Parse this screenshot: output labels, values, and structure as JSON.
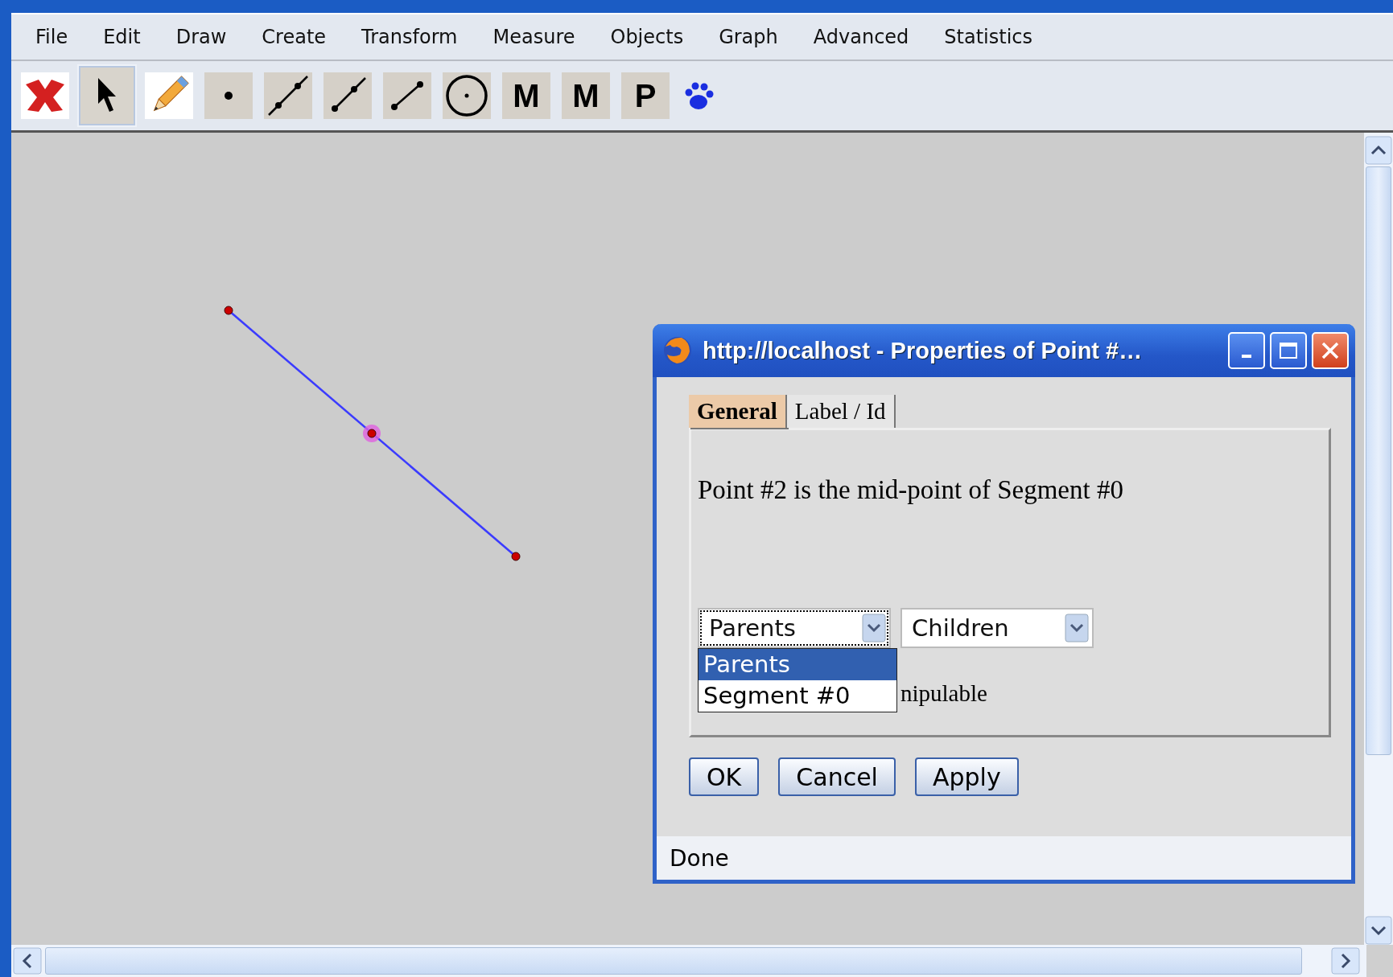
{
  "menu": [
    "File",
    "Edit",
    "Draw",
    "Create",
    "Transform",
    "Measure",
    "Objects",
    "Graph",
    "Advanced",
    "Statistics"
  ],
  "toolbar": [
    {
      "kind": "logo",
      "selected": false
    },
    {
      "kind": "arrow",
      "selected": true
    },
    {
      "kind": "pencil",
      "selected": false
    },
    {
      "kind": "point",
      "selected": false
    },
    {
      "kind": "line",
      "selected": false
    },
    {
      "kind": "ray",
      "selected": false
    },
    {
      "kind": "segment",
      "selected": false
    },
    {
      "kind": "circle",
      "selected": false
    },
    {
      "kind": "letter",
      "label": "M",
      "selected": false
    },
    {
      "kind": "letter",
      "label": "M",
      "selected": false
    },
    {
      "kind": "letter",
      "label": "P",
      "selected": false
    },
    {
      "kind": "paw",
      "selected": false
    }
  ],
  "dialog": {
    "title": "http://localhost - Properties of Point #…",
    "tabs": [
      {
        "label": "General",
        "selected": true
      },
      {
        "label": "Label / Id",
        "selected": false
      }
    ],
    "message": "Point #2 is the mid-point of Segment #0",
    "selects": [
      {
        "value": "Parents",
        "open": true,
        "options": [
          {
            "label": "Parents",
            "selected": true
          },
          {
            "label": "Segment #0",
            "selected": false
          }
        ]
      },
      {
        "value": "Children",
        "open": false
      }
    ],
    "partial_text": "nipulable",
    "buttons": [
      "OK",
      "Cancel",
      "Apply"
    ],
    "status": "Done"
  }
}
